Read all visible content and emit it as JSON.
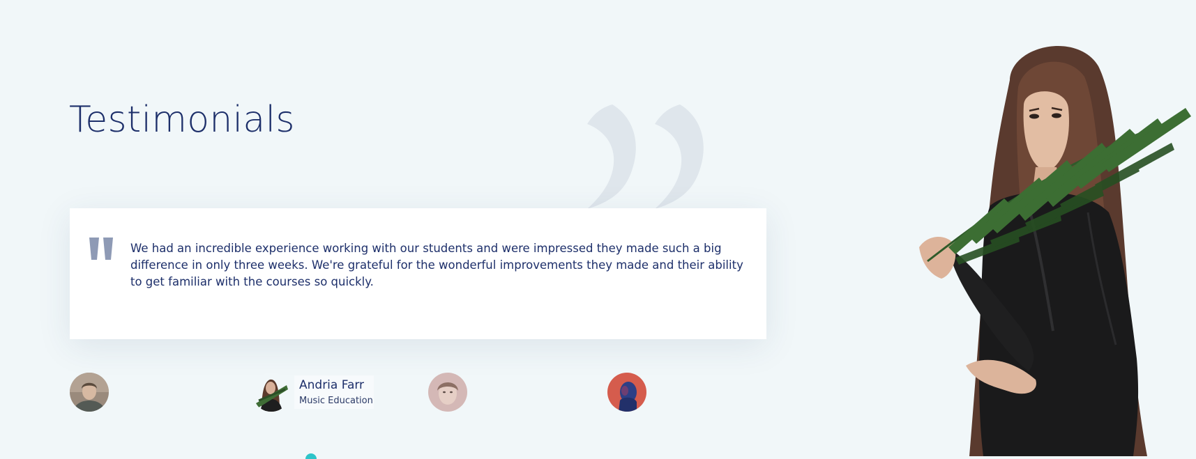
{
  "section": {
    "title": "Testimonials"
  },
  "testimonial": {
    "text": "We had an incredible experience working with our students and were impressed they made such a big difference in only three weeks. We're grateful for the wonderful improvements they made and their ability to get familiar with the courses so quickly."
  },
  "people": [
    {
      "name": "",
      "role": "",
      "active": false
    },
    {
      "name": "Andria Farr",
      "role": "Music Education",
      "active": true
    },
    {
      "name": "",
      "role": "",
      "active": false
    },
    {
      "name": "",
      "role": "",
      "active": false
    }
  ],
  "icons": {
    "big_quote": "quote-icon",
    "card_quote": "quote-icon"
  },
  "colors": {
    "background": "#f1f7f9",
    "title": "#1d2f6a",
    "card": "#ffffff",
    "big_quote": "#dfe6ec",
    "card_quote": "#8e9ab5",
    "accent": "#2ec4c9"
  }
}
